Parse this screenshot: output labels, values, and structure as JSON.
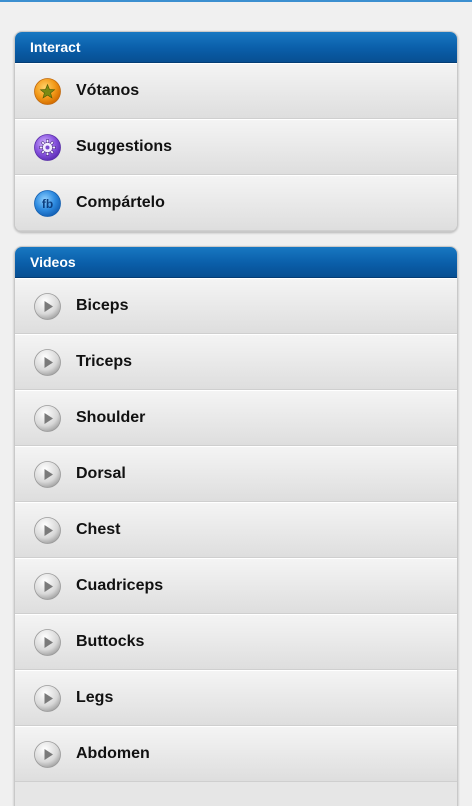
{
  "interact": {
    "header": "Interact",
    "items": [
      {
        "label": "Vótanos",
        "icon": "star-icon"
      },
      {
        "label": "Suggestions",
        "icon": "gear-icon"
      },
      {
        "label": "Compártelo",
        "icon": "facebook-icon"
      }
    ]
  },
  "videos": {
    "header": "Videos",
    "items": [
      {
        "label": "Biceps",
        "icon": "play-icon"
      },
      {
        "label": "Triceps",
        "icon": "play-icon"
      },
      {
        "label": "Shoulder",
        "icon": "play-icon"
      },
      {
        "label": "Dorsal",
        "icon": "play-icon"
      },
      {
        "label": "Chest",
        "icon": "play-icon"
      },
      {
        "label": "Cuadriceps",
        "icon": "play-icon"
      },
      {
        "label": "Buttocks",
        "icon": "play-icon"
      },
      {
        "label": "Legs",
        "icon": "play-icon"
      },
      {
        "label": "Abdomen",
        "icon": "play-icon"
      }
    ]
  },
  "colors": {
    "header_blue": "#0a5ea9",
    "accent_top_rule": "#3c8fd0",
    "background": "#f0f0f0"
  }
}
